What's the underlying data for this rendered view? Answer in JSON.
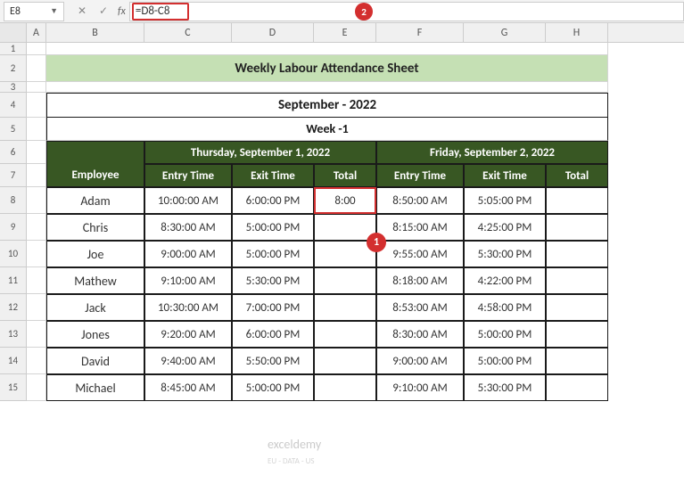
{
  "nameBox": "E8",
  "formula": "=D8-C8",
  "callouts": {
    "c1": "1",
    "c2": "2"
  },
  "columns": [
    "A",
    "B",
    "C",
    "D",
    "E",
    "F",
    "G",
    "H"
  ],
  "rowNums": [
    "1",
    "2",
    "3",
    "4",
    "5",
    "6",
    "7",
    "8",
    "9",
    "10",
    "11",
    "12",
    "13",
    "14",
    "15"
  ],
  "title": "Weekly Labour Attendance Sheet",
  "month": "September - 2022",
  "week": "Week -1",
  "day1": "Thursday, September 1, 2022",
  "day2": "Friday, September 2, 2022",
  "subheaders": {
    "employee": "Employee",
    "entry": "Entry Time",
    "exit": "Exit Time",
    "total": "Total"
  },
  "rows": [
    {
      "name": "Adam",
      "d1e": "10:00:00 AM",
      "d1x": "6:00:00 PM",
      "d1t": "8:00",
      "d2e": "8:50:00 AM",
      "d2x": "5:05:00 PM",
      "d2t": ""
    },
    {
      "name": "Chris",
      "d1e": "8:30:00 AM",
      "d1x": "5:00:00 PM",
      "d1t": "",
      "d2e": "8:15:00 AM",
      "d2x": "4:25:00 PM",
      "d2t": ""
    },
    {
      "name": "Joe",
      "d1e": "9:00:00 AM",
      "d1x": "5:00:00 PM",
      "d1t": "",
      "d2e": "9:55:00 AM",
      "d2x": "5:30:00 PM",
      "d2t": ""
    },
    {
      "name": "Mathew",
      "d1e": "9:10:00 AM",
      "d1x": "5:30:00 PM",
      "d1t": "",
      "d2e": "8:18:00 AM",
      "d2x": "4:22:00 PM",
      "d2t": ""
    },
    {
      "name": "Jack",
      "d1e": "10:30:00 AM",
      "d1x": "7:00:00 PM",
      "d1t": "",
      "d2e": "8:53:00 AM",
      "d2x": "4:58:00 PM",
      "d2t": ""
    },
    {
      "name": "Jones",
      "d1e": "9:20:00 AM",
      "d1x": "6:00:00 PM",
      "d1t": "",
      "d2e": "8:30:00 AM",
      "d2x": "5:00:00 PM",
      "d2t": ""
    },
    {
      "name": "David",
      "d1e": "9:40:00 AM",
      "d1x": "5:50:00 PM",
      "d1t": "",
      "d2e": "9:00:00 AM",
      "d2x": "5:00:00 PM",
      "d2t": ""
    },
    {
      "name": "Michael",
      "d1e": "8:45:00 AM",
      "d1x": "5:00:00 PM",
      "d1t": "",
      "d2e": "9:10:00 AM",
      "d2x": "5:30:00 PM",
      "d2t": ""
    }
  ],
  "watermark": {
    "main": "exceldemy",
    "sub": "EU - DATA - US"
  },
  "chart_data": {
    "type": "table",
    "title": "Weekly Labour Attendance Sheet",
    "subtitle": "September - 2022 / Week -1",
    "columns": [
      "Employee",
      "Thu Entry",
      "Thu Exit",
      "Thu Total",
      "Fri Entry",
      "Fri Exit",
      "Fri Total"
    ],
    "data": [
      [
        "Adam",
        "10:00:00 AM",
        "6:00:00 PM",
        "8:00",
        "8:50:00 AM",
        "5:05:00 PM",
        ""
      ],
      [
        "Chris",
        "8:30:00 AM",
        "5:00:00 PM",
        "",
        "8:15:00 AM",
        "4:25:00 PM",
        ""
      ],
      [
        "Joe",
        "9:00:00 AM",
        "5:00:00 PM",
        "",
        "9:55:00 AM",
        "5:30:00 PM",
        ""
      ],
      [
        "Mathew",
        "9:10:00 AM",
        "5:30:00 PM",
        "",
        "8:18:00 AM",
        "4:22:00 PM",
        ""
      ],
      [
        "Jack",
        "10:30:00 AM",
        "7:00:00 PM",
        "",
        "8:53:00 AM",
        "4:58:00 PM",
        ""
      ],
      [
        "Jones",
        "9:20:00 AM",
        "6:00:00 PM",
        "",
        "8:30:00 AM",
        "5:00:00 PM",
        ""
      ],
      [
        "David",
        "9:40:00 AM",
        "5:50:00 PM",
        "",
        "9:00:00 AM",
        "5:00:00 PM",
        ""
      ],
      [
        "Michael",
        "8:45:00 AM",
        "5:00:00 PM",
        "",
        "9:10:00 AM",
        "5:30:00 PM",
        ""
      ]
    ]
  }
}
